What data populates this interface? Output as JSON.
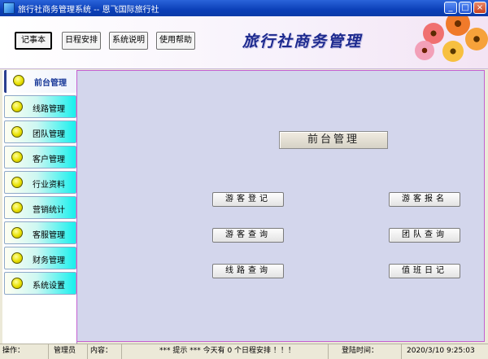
{
  "window": {
    "title": "旅行社商务管理系统 -- 恩飞国际旅行社",
    "min": "_",
    "max": "□",
    "close": "×"
  },
  "toolbar": {
    "buttons": [
      "记事本",
      "日程安排",
      "系统说明",
      "使用帮助"
    ],
    "banner": "旅行社商务管理"
  },
  "sidebar": {
    "items": [
      "前台管理",
      "线路管理",
      "团队管理",
      "客户管理",
      "行业资料",
      "营销统计",
      "客服管理",
      "财务管理",
      "系统设置"
    ]
  },
  "main": {
    "panel_title": "前台管理",
    "actions": {
      "visitor_register": "游客登记",
      "visitor_signup": "游客报名",
      "visitor_query": "游客查询",
      "team_query": "团队查询",
      "route_query": "线路查询",
      "duty_log": "值班日记"
    }
  },
  "status": {
    "operation_label": "操作：",
    "user": "管理员",
    "content_label": "内容：",
    "message": "*** 提示 ***   今天有 0 个日程安排 ！！！",
    "login_label": "登陆时间：",
    "login_time": "2020/3/10 9:25:03"
  },
  "colors": {
    "titlebar": "#0b3fb8",
    "nav_accent": "#18f0ee",
    "main_bg": "#d3d6ec",
    "main_border": "#c55fd0"
  }
}
